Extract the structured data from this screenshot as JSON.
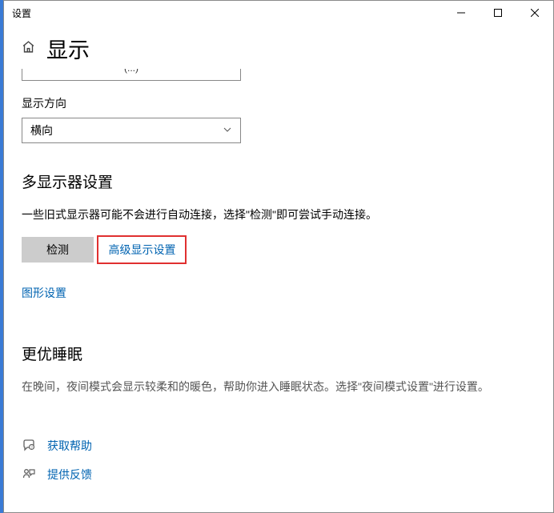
{
  "titlebar": {
    "title": "设置"
  },
  "header": {
    "title": "显示"
  },
  "partialField": {
    "fragment": "(...)"
  },
  "orientation": {
    "label": "显示方向",
    "value": "横向"
  },
  "multiDisplay": {
    "heading": "多显示器设置",
    "description": "一些旧式显示器可能不会进行自动连接，选择\"检测\"即可尝试手动连接。",
    "detectButton": "检测",
    "advancedLink": "高级显示设置",
    "graphicsLink": "图形设置"
  },
  "sleep": {
    "heading": "更优睡眠",
    "description": "在晚间，夜间模式会显示较柔和的暖色，帮助你进入睡眠状态。选择\"夜间模式设置\"进行设置。"
  },
  "footer": {
    "help": "获取帮助",
    "feedback": "提供反馈"
  }
}
